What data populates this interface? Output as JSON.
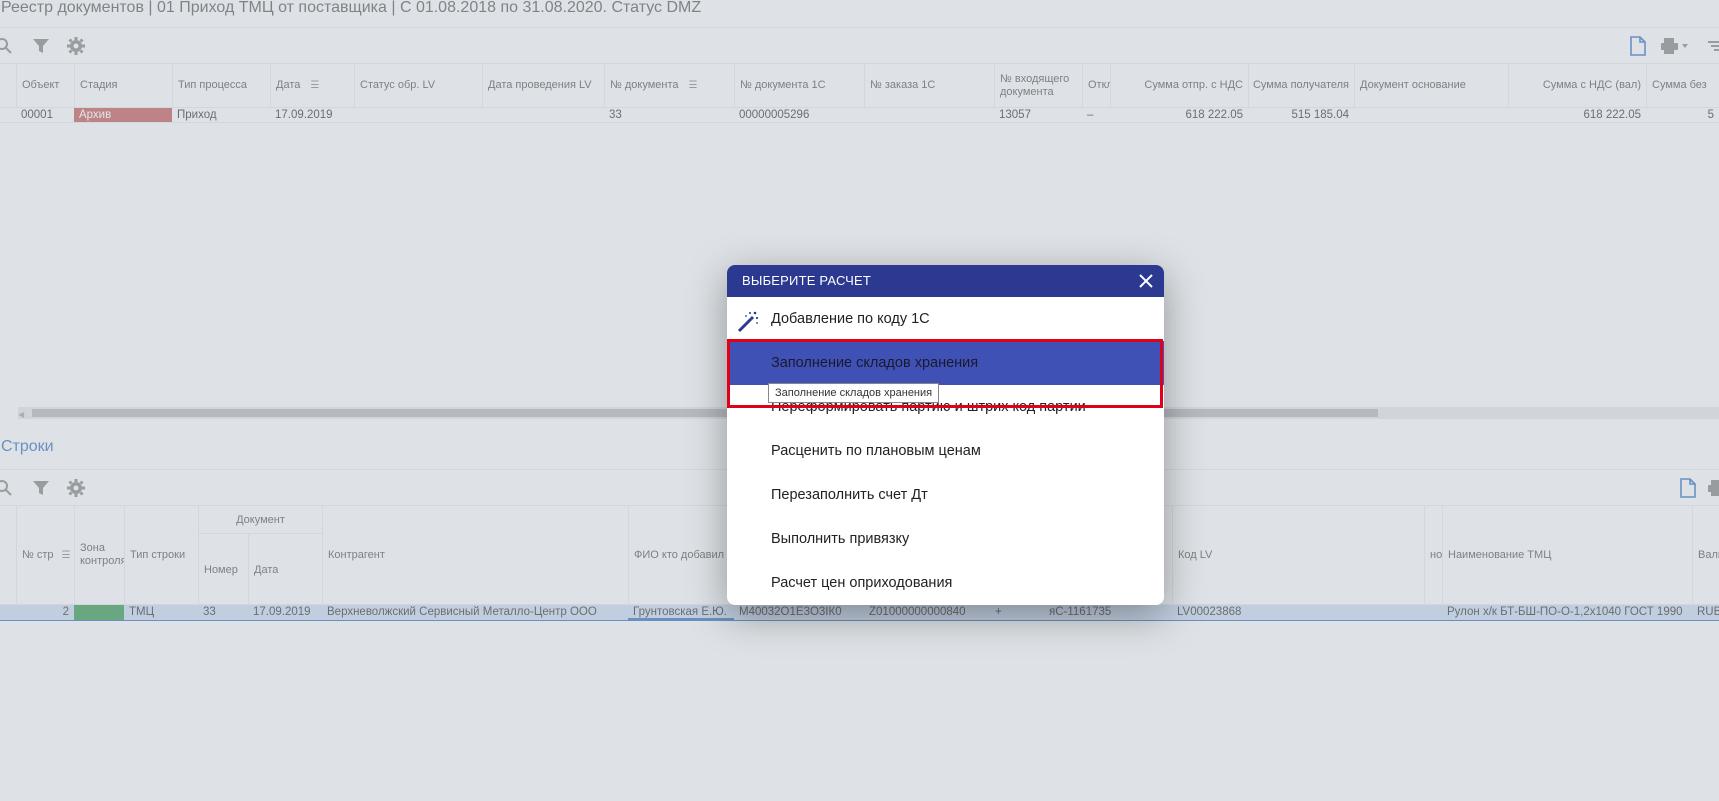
{
  "title": "Реестр документов | 01 Приход ТМЦ от поставщика | С 01.08.2018 по 31.08.2020. Статус DMZ",
  "top_grid": {
    "headers": [
      "Объект",
      "Стадия",
      "Тип процесса",
      "Дата",
      "Статус обр. LV",
      "Дата проведения LV",
      "№ документа",
      "№ документа 1С",
      "№ заказа 1С",
      "№ входящего документа",
      "Откл",
      "Сумма отпр. с НДС",
      "Сумма получателя",
      "Документ основание",
      "Сумма с НДС (вал)",
      "Сумма без"
    ],
    "row": {
      "object": "00001",
      "stage": "Архив",
      "process": "Приход",
      "date": "17.09.2019",
      "doc_no": "33",
      "doc_1c": "00000005296",
      "incoming": "13057",
      "dev": "–",
      "sum_send": "618 222.05",
      "sum_recv": "515 185.04",
      "sum_val": "618 222.05",
      "sum_wo": "5"
    }
  },
  "lines_section": {
    "title": "Строки",
    "group_header": "Документ",
    "headers": [
      "№ стр",
      "Зона контроля",
      "Тип строки",
      "Номер",
      "Дата",
      "Контрагент",
      "ФИО кто добавил",
      "Код LV",
      "нор",
      "Наименование ТМЦ",
      "Валю"
    ],
    "row": {
      "num": "2",
      "zone": "G",
      "type": "ТМЦ",
      "number": "33",
      "date": "17.09.2019",
      "contractor": "Верхневолжский Сервисный Металло-Центр ООО",
      "added_by": "Грунтовская Е.Ю.",
      "c1": "М40032О1Е3О3IК0",
      "c2": "Z01000000000840",
      "c3": "+",
      "c4": "яС-1161735",
      "code_lv": "LV00023868",
      "item_name": "Рулон х/к БТ-БШ-ПО-О-1,2х1040 ГОСТ 1990",
      "currency": "RUB"
    }
  },
  "dialog": {
    "title": "ВЫБЕРИТЕ РАСЧЕТ",
    "items": [
      "Добавление по коду 1С",
      "Заполнение складов хранения",
      "Переформировать партию и штрих код партии",
      "Расценить по плановым ценам",
      "Перезаполнить счет Дт",
      "Выполнить привязку",
      "Расчет цен оприходования"
    ],
    "tooltip": "Заполнение складов хранения"
  },
  "colors": {
    "dialog_header": "#2b3990",
    "active_item": "#3f51b5",
    "stage_archive": "#b84a4a",
    "zone_green": "#1e8a3c",
    "highlight_border": "#e0001a",
    "accent_blue": "#1e63b5"
  }
}
